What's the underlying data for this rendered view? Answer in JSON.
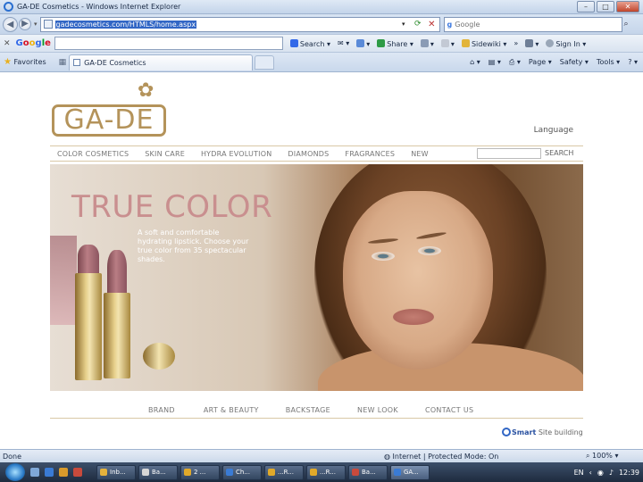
{
  "window": {
    "title": "GA-DE Cosmetics - Windows Internet Explorer",
    "buttons": [
      "–",
      "□",
      "✕"
    ]
  },
  "address": {
    "url": "gadecosmetics.com/HTMLS/home.aspx",
    "search_placeholder": "Google"
  },
  "google_toolbar": {
    "logo": [
      "G",
      "o",
      "o",
      "g",
      "l",
      "e"
    ],
    "items": [
      "Search ▾",
      "✉ ▾",
      "▾",
      "Share ▾",
      "▾",
      "▾",
      "Sidewiki ▾",
      "»",
      "▾",
      "Sign In ▾"
    ]
  },
  "tabs": {
    "favorites": "Favorites",
    "current": "GA-DE Cosmetics",
    "commands": [
      "▾",
      "▾",
      "▾",
      "Page ▾",
      "Safety ▾",
      "Tools ▾",
      "? ▾"
    ]
  },
  "site": {
    "logo_text": "GA-DE",
    "language": "Language",
    "nav": [
      "COLOR COSMETICS",
      "SKIN CARE",
      "HYDRA EVOLUTION",
      "DIAMONDS",
      "FRAGRANCES",
      "NEW"
    ],
    "search_label": "SEARCH",
    "hero": {
      "headline": "TRUE COLOR",
      "copy": "A soft and comfortable hydrating lipstick. Choose your true color from 35 spectacular shades."
    },
    "footer_nav": [
      "BRAND",
      "ART & BEAUTY",
      "BACKSTAGE",
      "NEW LOOK",
      "CONTACT US"
    ],
    "credit_brand": "Smart",
    "credit_text": "Site building"
  },
  "status": {
    "left": "Done",
    "zone": "Internet | Protected Mode: On",
    "zoom": "100% ▾"
  },
  "taskbar": {
    "buttons": [
      "Inb...",
      "Ba...",
      "2 ...",
      "Ch...",
      "...R...",
      "...R...",
      "Ba...",
      "GA..."
    ],
    "lang": "EN",
    "clock": "12:39"
  },
  "colors": {
    "accent_gold": "#b4935a",
    "headline_pink": "#c98f8f",
    "url_highlight": "#3166c5"
  }
}
